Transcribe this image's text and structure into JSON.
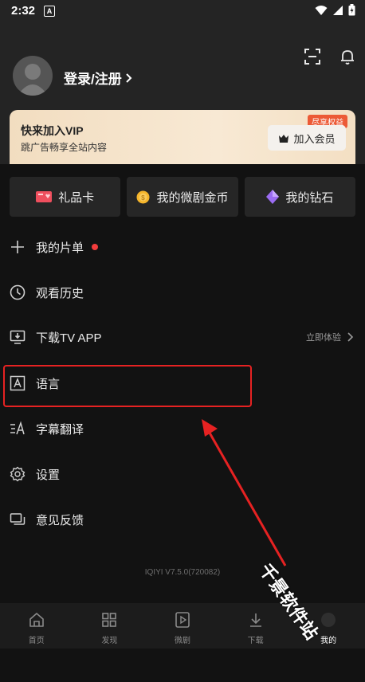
{
  "status_bar": {
    "time": "2:32",
    "a_label": "A"
  },
  "profile": {
    "login_label": "登录/注册"
  },
  "vip": {
    "title": "快来加入VIP",
    "subtitle": "跳广告畅享全站内容",
    "badge": "尽享权益",
    "join_label": "加入会员"
  },
  "quick_actions": [
    {
      "label": "礼品卡",
      "icon": "gift-card-icon"
    },
    {
      "label": "我的微剧金币",
      "icon": "coin-icon"
    },
    {
      "label": "我的钻石",
      "icon": "diamond-icon"
    }
  ],
  "menu": [
    {
      "label": "我的片单",
      "icon": "plus-icon"
    },
    {
      "label": "观看历史",
      "icon": "clock-icon"
    },
    {
      "label": "下载TV APP",
      "icon": "tv-download-icon",
      "trail": "立即体验"
    },
    {
      "label": "语言",
      "icon": "language-icon"
    },
    {
      "label": "字幕翻译",
      "icon": "subtitle-translate-icon"
    },
    {
      "label": "设置",
      "icon": "gear-icon"
    },
    {
      "label": "意见反馈",
      "icon": "feedback-icon"
    }
  ],
  "version": "IQIYI V7.5.0(720082)",
  "bottom_nav": [
    {
      "label": "首页",
      "icon": "home-icon"
    },
    {
      "label": "发现",
      "icon": "grid-icon"
    },
    {
      "label": "微剧",
      "icon": "play-icon"
    },
    {
      "label": "下载",
      "icon": "download-icon"
    },
    {
      "label": "我的",
      "icon": "me-icon",
      "active": true
    }
  ],
  "watermark": "千景软件站",
  "colors": {
    "accent_red": "#e62222",
    "vip_badge": "#ec5a36",
    "background": "#121212"
  }
}
